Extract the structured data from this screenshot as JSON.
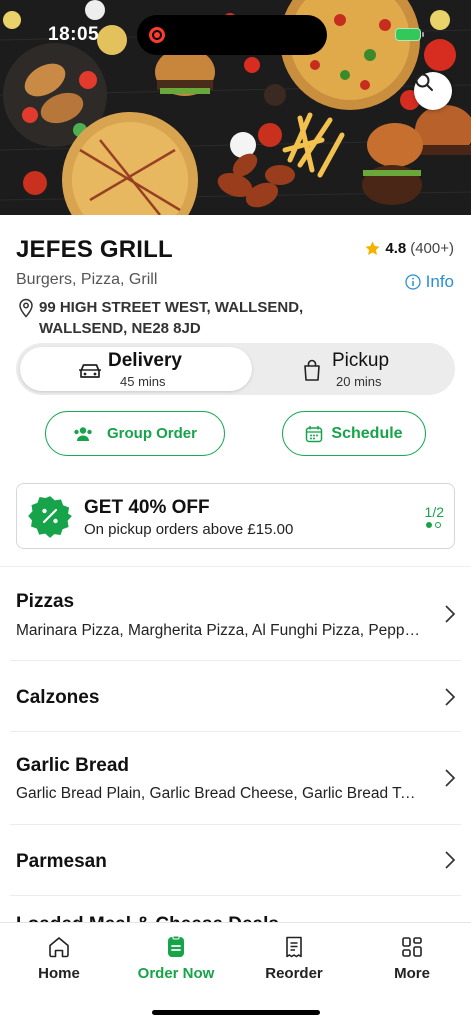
{
  "status": {
    "time": "18:05"
  },
  "restaurant": {
    "name": "JEFES GRILL",
    "rating": "4.8",
    "rating_count": "(400+)",
    "cuisine": "Burgers, Pizza, Grill",
    "info_label": "Info",
    "address": "99 HIGH STREET WEST, WALLSEND, WALLSEND, NE28 8JD"
  },
  "order_type": {
    "selected": "Delivery",
    "delivery": {
      "label": "Delivery",
      "time": "45 mins"
    },
    "pickup": {
      "label": "Pickup",
      "time": "20 mins"
    }
  },
  "actions": {
    "group_order": "Group Order",
    "schedule": "Schedule"
  },
  "promo": {
    "title": "GET 40% OFF",
    "description": "On pickup orders above £15.00",
    "pager": "1/2",
    "pages": 2,
    "current_page": 1
  },
  "categories": [
    {
      "name": "Pizzas",
      "items": "Marinara Pizza, Margherita Pizza, Al Funghi Pizza, Pepperoni Pizza"
    },
    {
      "name": "Calzones",
      "items": ""
    },
    {
      "name": "Garlic Bread",
      "items": "Garlic Bread Plain, Garlic Bread Cheese, Garlic Bread Tomato"
    },
    {
      "name": "Parmesan",
      "items": ""
    }
  ],
  "peek_category": "Loaded Meal & Cheese Deals",
  "nav": [
    {
      "label": "Home",
      "icon": "home-icon"
    },
    {
      "label": "Order Now",
      "icon": "order-icon",
      "active": true
    },
    {
      "label": "Reorder",
      "icon": "receipt-icon"
    },
    {
      "label": "More",
      "icon": "grid-icon"
    }
  ],
  "colors": {
    "accent": "#17a34a",
    "link": "#2b8fd6",
    "star": "#f5b301"
  }
}
